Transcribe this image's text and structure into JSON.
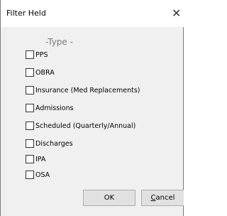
{
  "window": {
    "title": "Filter Held",
    "close_glyph": "✕"
  },
  "group": {
    "label": "-Type -"
  },
  "options": [
    {
      "label": "PPS",
      "checked": false
    },
    {
      "label": "OBRA",
      "checked": false
    },
    {
      "label": "Insurance (Med Replacements)",
      "checked": false
    },
    {
      "label": "Admissions",
      "checked": false
    },
    {
      "label": "Scheduled (Quarterly/Annual)",
      "checked": false
    },
    {
      "label": "Discharges",
      "checked": false
    },
    {
      "label": "IPA",
      "checked": false
    },
    {
      "label": "OSA",
      "checked": false
    }
  ],
  "buttons": {
    "ok": "OK",
    "cancel_mnemonic": "C",
    "cancel_rest": "ancel"
  }
}
